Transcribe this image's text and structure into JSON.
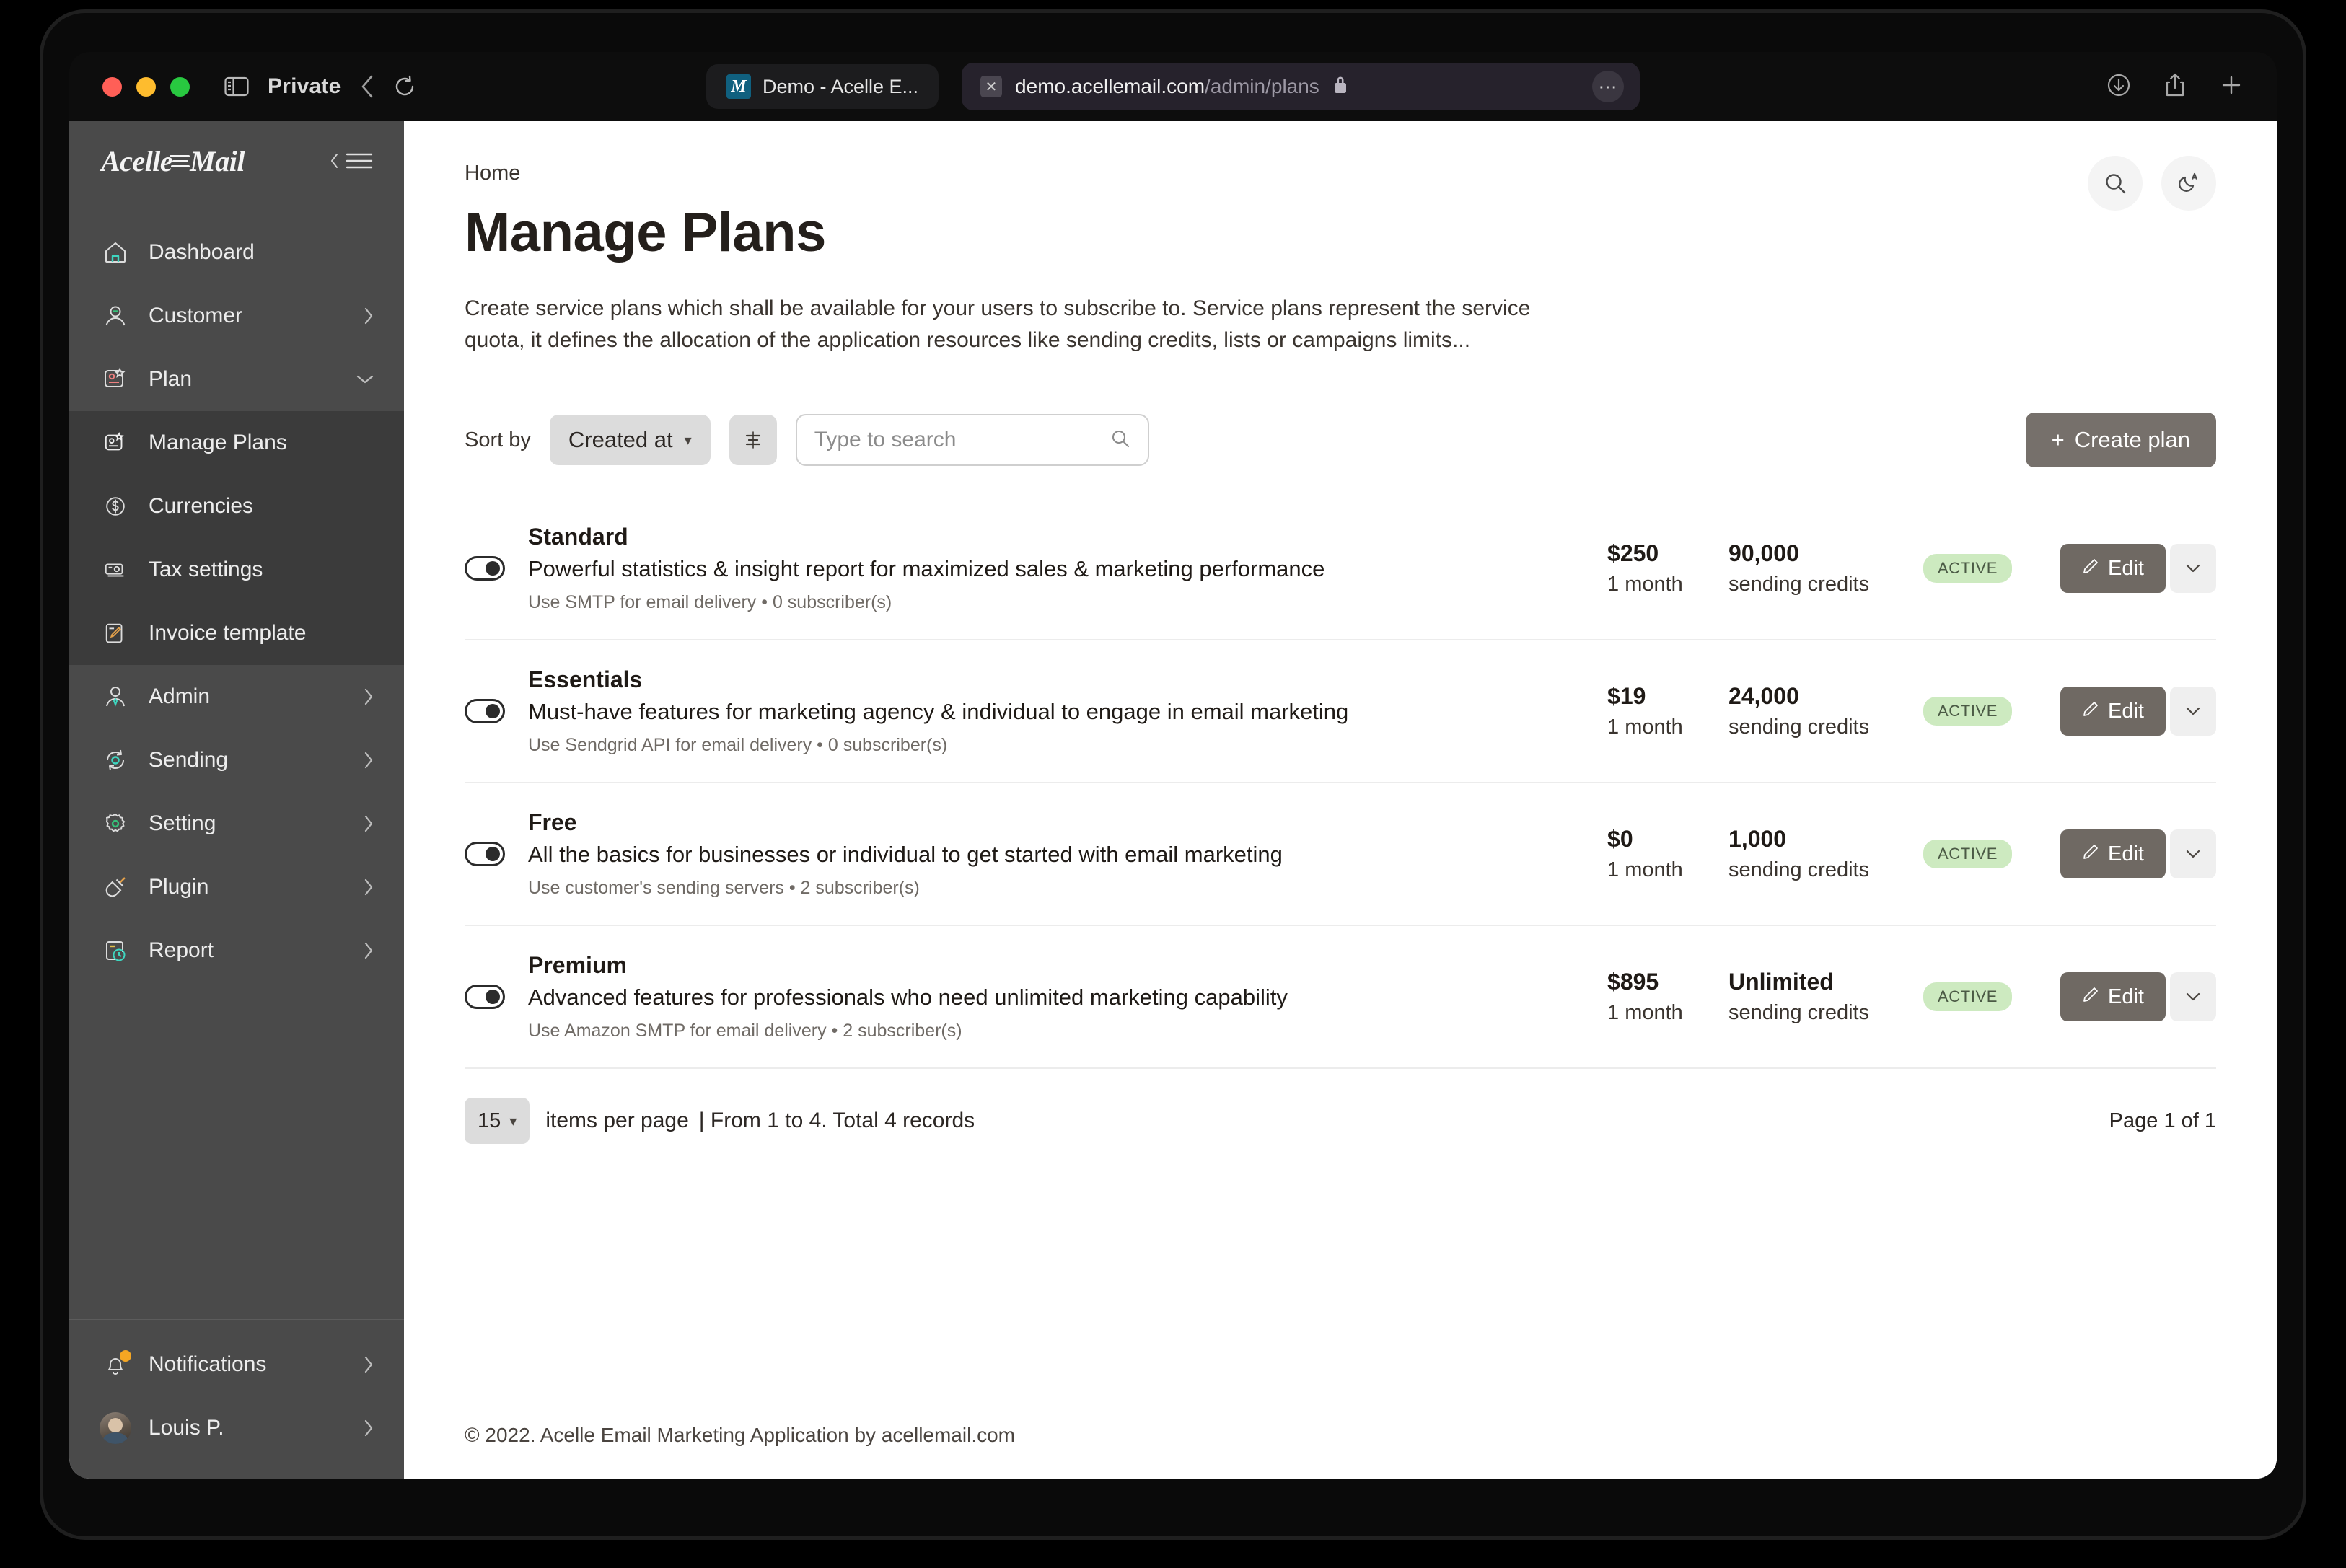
{
  "browser": {
    "private_label": "Private",
    "tab": {
      "favicon_letter": "M",
      "title": "Demo - Acelle E..."
    },
    "url": {
      "domain": "demo.acellemail.com",
      "path": "/admin/plans",
      "dots": "⋯"
    },
    "icons": {
      "sidebar_toggle": "sidebar-toggle-icon",
      "back": "back-chevron-icon",
      "reload": "reload-icon",
      "downloads": "downloads-icon",
      "share": "share-icon",
      "new_tab": "new-tab-icon",
      "lock": "lock-icon"
    }
  },
  "sidebar": {
    "brand": {
      "text_a": "Acelle",
      "text_b": "Mail"
    },
    "collapse_label": "collapse-sidebar",
    "items": [
      {
        "label": "Dashboard",
        "icon": "home-icon",
        "chevron": "",
        "active": false
      },
      {
        "label": "Customer",
        "icon": "user-icon",
        "chevron": "›",
        "active": false
      },
      {
        "label": "Plan",
        "icon": "plan-card-icon",
        "chevron": "∨",
        "active": true
      }
    ],
    "submenu": [
      {
        "label": "Manage Plans",
        "icon": "plan-card-icon",
        "active": true
      },
      {
        "label": "Currencies",
        "icon": "dollar-circle-icon",
        "active": false
      },
      {
        "label": "Tax settings",
        "icon": "money-bill-icon",
        "active": false
      },
      {
        "label": "Invoice template",
        "icon": "invoice-edit-icon",
        "active": false
      }
    ],
    "items_lower": [
      {
        "label": "Admin",
        "icon": "admin-user-icon",
        "chevron": "›"
      },
      {
        "label": "Sending",
        "icon": "sending-refresh-icon",
        "chevron": "›"
      },
      {
        "label": "Setting",
        "icon": "gear-icon",
        "chevron": "›"
      },
      {
        "label": "Plugin",
        "icon": "plug-icon",
        "chevron": "›"
      },
      {
        "label": "Report",
        "icon": "report-clock-icon",
        "chevron": "›"
      }
    ],
    "bottom": [
      {
        "label": "Notifications",
        "icon": "bell-icon",
        "chevron": "›",
        "badge": true
      },
      {
        "label": "Louis P.",
        "icon": "avatar",
        "chevron": "›",
        "badge": false
      }
    ]
  },
  "header": {
    "breadcrumb": "Home",
    "title": "Manage Plans",
    "description": "Create service plans which shall be available for your users to subscribe to. Service plans represent the service quota, it defines the allocation of the application resources like sending credits, lists or campaigns limits...",
    "search_icon": "search-icon",
    "theme_icon": "dark-mode-auto-icon"
  },
  "toolbar": {
    "sort_label": "Sort by",
    "sort_value": "Created at",
    "sort_caret": "▾",
    "sort_direction_icon": "sort-direction-icon",
    "search_placeholder": "Type to search",
    "search_value": "",
    "search_icon": "search-icon",
    "create_label": "Create plan",
    "create_plus": "+"
  },
  "plans": [
    {
      "name": "Standard",
      "description": "Powerful statistics & insight report for maximized sales & marketing performance",
      "meta": "Use SMTP for email delivery • 0 subscriber(s)",
      "price": "$250",
      "period": "1 month",
      "credits": "90,000",
      "credits_label": "sending credits",
      "status": "ACTIVE",
      "edit_label": "Edit",
      "enabled": true
    },
    {
      "name": "Essentials",
      "description": "Must-have features for marketing agency & individual to engage in email marketing",
      "meta": "Use Sendgrid API for email delivery • 0 subscriber(s)",
      "price": "$19",
      "period": "1 month",
      "credits": "24,000",
      "credits_label": "sending credits",
      "status": "ACTIVE",
      "edit_label": "Edit",
      "enabled": true
    },
    {
      "name": "Free",
      "description": "All the basics for businesses or individual to get started with email marketing",
      "meta": "Use customer's sending servers • 2 subscriber(s)",
      "price": "$0",
      "period": "1 month",
      "credits": "1,000",
      "credits_label": "sending credits",
      "status": "ACTIVE",
      "edit_label": "Edit",
      "enabled": true
    },
    {
      "name": "Premium",
      "description": "Advanced features for professionals who need unlimited marketing capability",
      "meta": "Use Amazon SMTP for email delivery • 2 subscriber(s)",
      "price": "$895",
      "period": "1 month",
      "credits": "Unlimited",
      "credits_label": "sending credits",
      "status": "ACTIVE",
      "edit_label": "Edit",
      "enabled": true
    }
  ],
  "pagination": {
    "per_page_value": "15",
    "per_page_caret": "▾",
    "per_page_label": "items per page",
    "range_text": "| From 1 to 4. Total 4 records",
    "page_text": "Page 1 of 1"
  },
  "footer": {
    "text": "© 2022. Acelle Email Marketing Application by acellemail.com"
  },
  "colors": {
    "sidebar_bg": "#4a4a4a",
    "submenu_bg": "#3b3b3b",
    "accent_button": "#76706b",
    "badge_bg": "#cdeac0",
    "badge_text": "#4b5a45"
  }
}
